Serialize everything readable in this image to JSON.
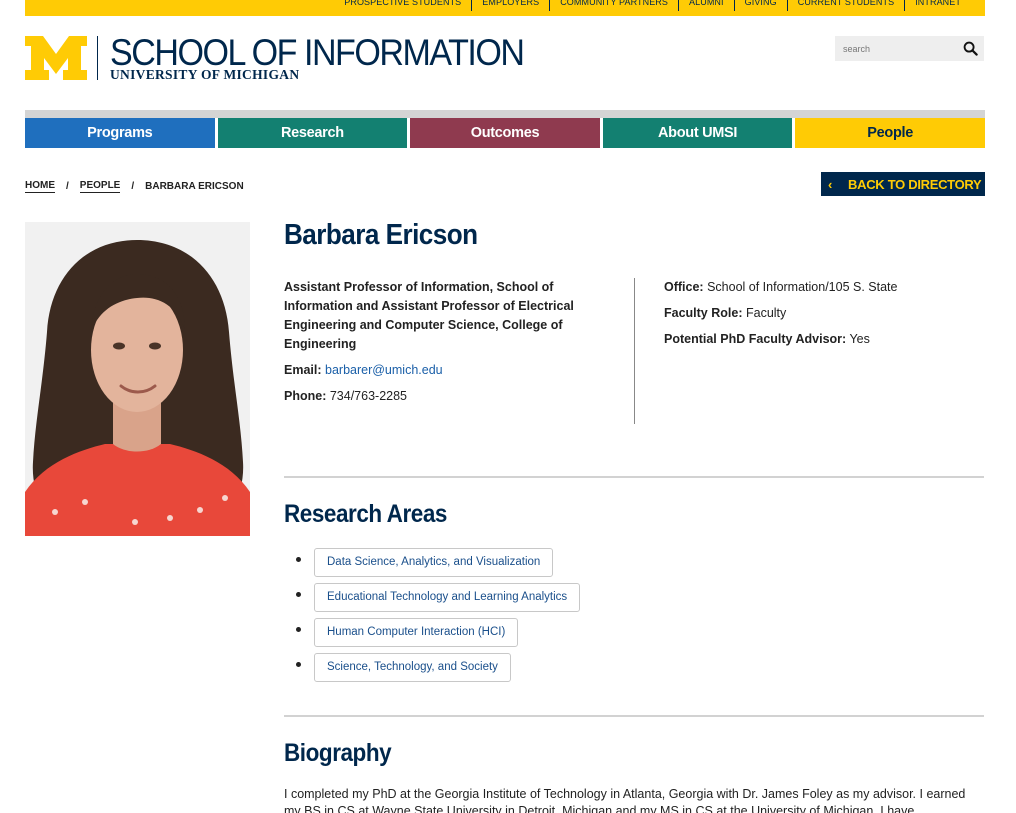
{
  "utility_nav": [
    "PROSPECTIVE STUDENTS",
    "EMPLOYERS",
    "COMMUNITY PARTNERS",
    "ALUMNI",
    "GIVING",
    "CURRENT STUDENTS",
    "INTRANET"
  ],
  "logo": {
    "title": "SCHOOL OF INFORMATION",
    "subtitle": "UNIVERSITY OF MICHIGAN",
    "mark": "block-m-logo"
  },
  "search": {
    "placeholder": "search",
    "icon": "search-icon"
  },
  "main_nav": [
    {
      "label": "Programs",
      "color": "#1f6fbe",
      "text_color": "#ffffff"
    },
    {
      "label": "Research",
      "color": "#138071",
      "text_color": "#ffffff"
    },
    {
      "label": "Outcomes",
      "color": "#8f3a4f",
      "text_color": "#ffffff"
    },
    {
      "label": "About UMSI",
      "color": "#138071",
      "text_color": "#ffffff"
    },
    {
      "label": "People",
      "color": "#ffcb05",
      "text_color": "#00274c"
    }
  ],
  "breadcrumb": {
    "home": "HOME",
    "people": "PEOPLE",
    "current": "BARBARA ERICSON",
    "separator": "/"
  },
  "back_button": {
    "chevron": "‹",
    "label": "BACK TO DIRECTORY"
  },
  "profile": {
    "name": "Barbara Ericson",
    "title": "Assistant Professor of Information, School of Information and Assistant Professor of Electrical Engineering and Computer Science, College of Engineering",
    "email_label": "Email:",
    "email": "barbarer@umich.edu",
    "phone_label": "Phone:",
    "phone": "734/763-2285",
    "office_label": "Office:",
    "office": "School of Information/105 S. State",
    "faculty_role_label": "Faculty Role:",
    "faculty_role": "Faculty",
    "advisor_label": "Potential PhD Faculty Advisor:",
    "advisor": "Yes"
  },
  "research": {
    "heading": "Research Areas",
    "areas": [
      "Data Science, Analytics, and Visualization",
      "Educational Technology and Learning Analytics",
      "Human Computer Interaction (HCI)",
      "Science, Technology, and Society"
    ]
  },
  "biography": {
    "heading": "Biography",
    "text": "I completed my PhD at the Georgia Institute of Technology in Atlanta, Georgia with Dr. James Foley as my advisor. I earned my BS in CS at Wayne State University in Detroit, Michigan and my MS in CS at the University of Michigan. I have"
  },
  "colors": {
    "maize": "#ffcb05",
    "blue": "#00274c",
    "link": "#1a5fa8"
  }
}
